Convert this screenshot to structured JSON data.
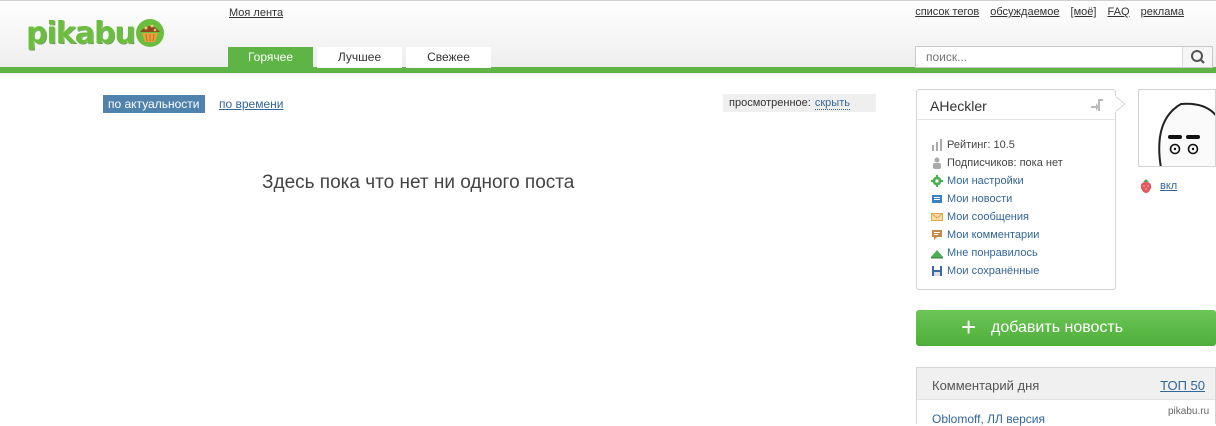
{
  "header": {
    "logo_text": "pikabu",
    "my_feed": "Моя лента",
    "top_links": [
      "список тегов",
      "обсуждаемое",
      "[моё]",
      "FAQ",
      "реклама"
    ],
    "tabs": [
      {
        "label": "Горячее",
        "active": true
      },
      {
        "label": "Лучшее",
        "active": false
      },
      {
        "label": "Свежее",
        "active": false
      }
    ],
    "search": {
      "placeholder": "поиск...",
      "icon": "magnifier-icon"
    }
  },
  "content": {
    "sort_active": "по актуальности",
    "sort_time": "по времени",
    "viewed_label": "просмотренное:",
    "viewed_hide": "скрыть",
    "empty_message": "Здесь пока что нет ни одного поста"
  },
  "sidebar": {
    "username": "AHeckler",
    "rating": "Рейтинг: 10.5",
    "subscribers": "Подписчиков: пока нет",
    "menu": [
      {
        "label": "Мои настройки",
        "icon": "gear-icon",
        "color": "#4caf50"
      },
      {
        "label": "Мои новости",
        "icon": "news-icon",
        "color": "#3a82c4"
      },
      {
        "label": "Мои сообщения",
        "icon": "envelope-icon",
        "color": "#e0a84a"
      },
      {
        "label": "Мои комментарии",
        "icon": "comment-icon",
        "color": "#c48a4a"
      },
      {
        "label": "Мне понравилось",
        "icon": "thumb-up-icon",
        "color": "#4caf50"
      },
      {
        "label": "Мои сохранённые",
        "icon": "floppy-icon",
        "color": "#3a6aa8"
      }
    ],
    "vkl": "вкл",
    "add_news": "добавить новость",
    "comment_of_day": "Комментарий дня",
    "top50": "ТОП 50",
    "comment_author": "Oblomoff, ЛЛ версия"
  },
  "watermark": "pikabu.ru",
  "colors": {
    "brand_green": "#5fb446",
    "link_blue": "#336699",
    "sort_blue": "#4f82ad"
  }
}
